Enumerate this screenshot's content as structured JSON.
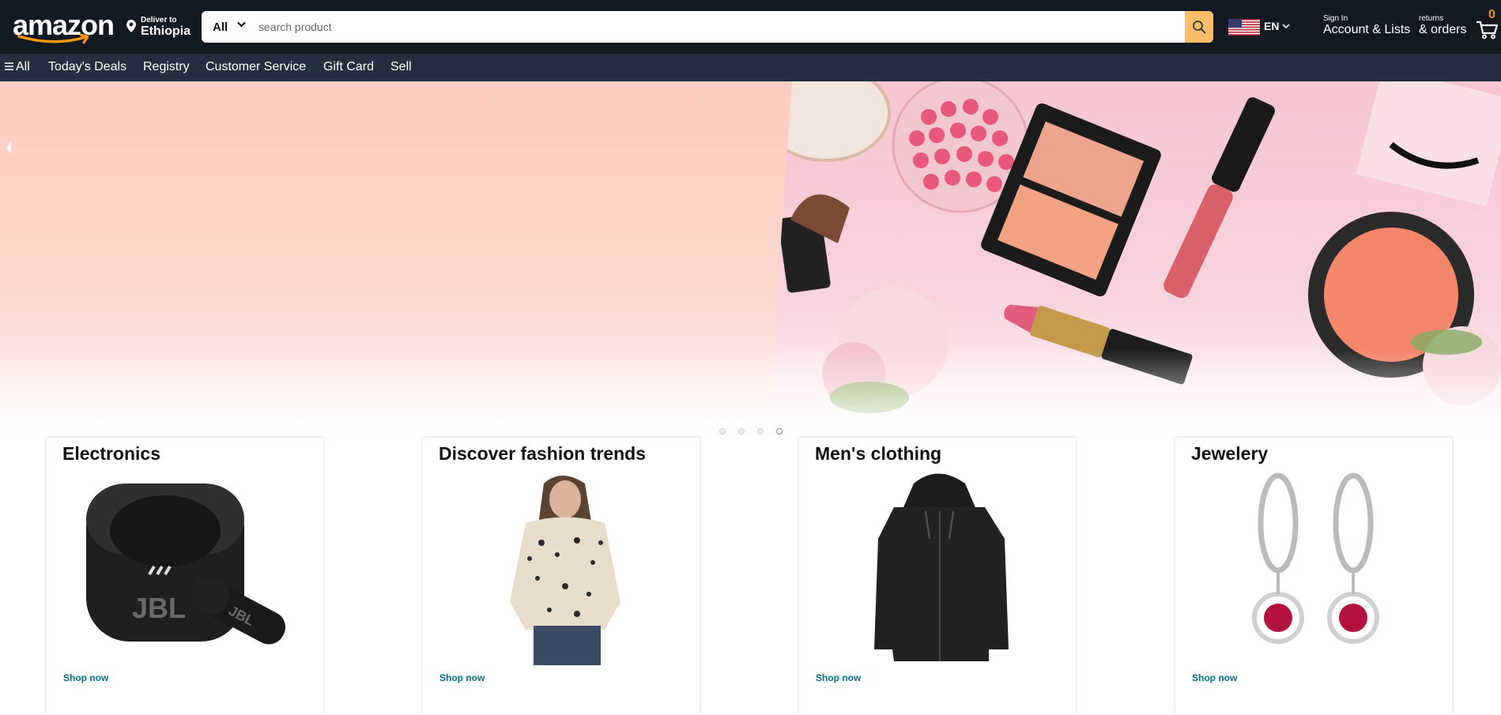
{
  "header": {
    "logo_text": "amazon",
    "deliver_small": "Deliver to",
    "deliver_location": "Ethiopia",
    "search": {
      "category": "All",
      "placeholder": "search product",
      "value": ""
    },
    "language": "EN",
    "account_small": "Sign In",
    "account_big": "Account & Lists",
    "orders_small": "returns",
    "orders_big": "& orders",
    "cart_count": "0"
  },
  "subnav": {
    "items": [
      "All",
      "Today's Deals",
      "Registry",
      "Customer Service",
      "Gift Card",
      "Sell"
    ]
  },
  "hero": {
    "slides": 4,
    "active_slide": 4
  },
  "cards": [
    {
      "title": "Electronics",
      "link": "Shop now",
      "image_icon": "earbuds-icon"
    },
    {
      "title": "Discover fashion trends",
      "link": "Shop now",
      "image_icon": "blouse-icon"
    },
    {
      "title": "Men's clothing",
      "link": "Shop now",
      "image_icon": "hoodie-icon"
    },
    {
      "title": "Jewelery",
      "link": "Shop now",
      "image_icon": "earrings-icon"
    }
  ],
  "colors": {
    "nav_top": "#131921",
    "nav_sub": "#232f3e",
    "search_button": "#febd69",
    "cart_count": "#f08804",
    "link": "#007185"
  }
}
